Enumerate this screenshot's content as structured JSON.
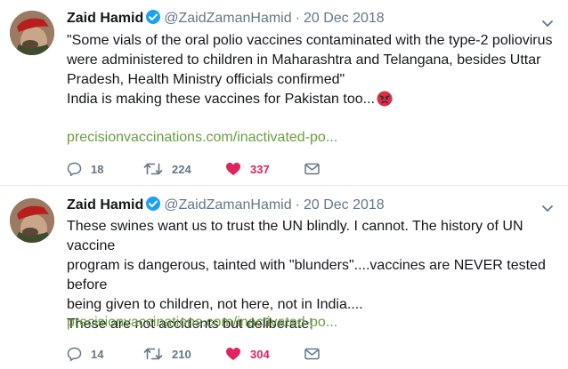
{
  "tweets": [
    {
      "name": "Zaid Hamid",
      "handle": "@ZaidZamanHamid",
      "separator": "·",
      "date": "20 Dec 2018",
      "lines": [
        "\"Some vials of the oral polio vaccines contaminated  with the type-2 poliovirus",
        "were administered to children in Maharashtra  and Telangana, besides Uttar",
        "Pradesh, Health Ministry officials  confirmed\"",
        "India is making these vaccines for Pakistan too..."
      ],
      "link": "precisionvaccinations.com/inactivated-po...",
      "replies": "18",
      "retweets": "224",
      "likes": "337"
    },
    {
      "name": "Zaid Hamid",
      "handle": "@ZaidZamanHamid",
      "separator": "·",
      "date": "20 Dec 2018",
      "lines": [
        "These swines want us to trust the UN blindly. I cannot. The history of UN vaccine",
        "program is dangerous, tainted with \"blunders\"....vaccines are NEVER tested before",
        "being given to children, not here, not in India....",
        "These are not accidents but deliberate!"
      ],
      "link": "precisionvaccinations.com/inactivated-po...",
      "replies": "14",
      "retweets": "210",
      "likes": "304"
    }
  ],
  "icons": {
    "verified": "verified-badge-icon",
    "caret": "chevron-down-icon",
    "reply": "reply-icon",
    "retweet": "retweet-icon",
    "like": "heart-icon",
    "dm": "envelope-icon",
    "emoji": "angry-face-emoji"
  },
  "colors": {
    "text": "#14171a",
    "muted": "#657786",
    "verified": "#1da1f2",
    "link": "#6b9e3e",
    "like": "#e0245e",
    "divider": "#e6ecf0"
  }
}
